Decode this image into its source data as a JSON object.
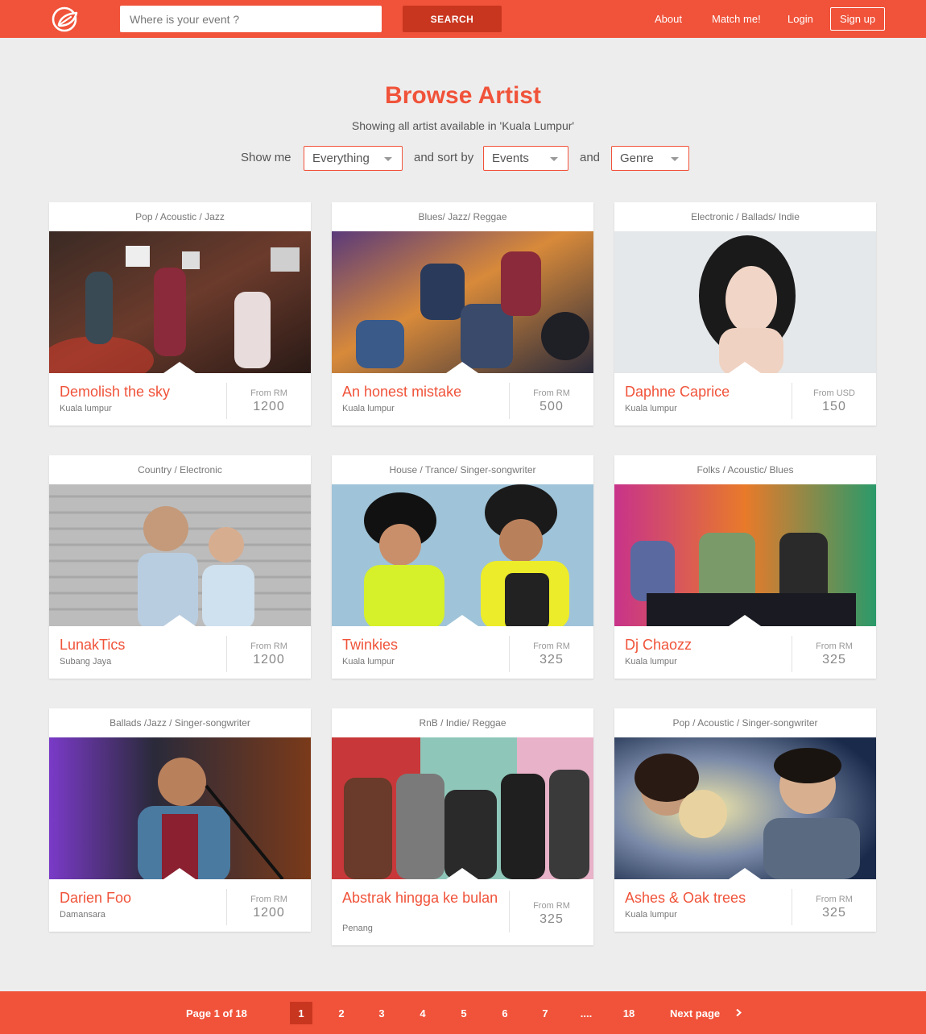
{
  "header": {
    "search_placeholder": "Where is your event ?",
    "search_button": "SEARCH",
    "nav": [
      "About",
      "Match me!",
      "Login"
    ],
    "signup": "Sign up",
    "logo_icon": "leaf-logo-icon"
  },
  "main": {
    "title": "Browse Artist",
    "subtitle": "Showing all artist available in 'Kuala Lumpur'",
    "filters": {
      "show_me_label": "Show me",
      "show_me_value": "Everything",
      "sort_label": "and sort by",
      "sort_value": "Events",
      "and_label": "and",
      "genre_value": "Genre"
    }
  },
  "artists": [
    {
      "genre": "Pop / Acoustic / Jazz",
      "name": "Demolish the sky",
      "city": "Kuala lumpur",
      "from": "From RM",
      "price": "1200"
    },
    {
      "genre": "Blues/ Jazz/ Reggae",
      "name": "An honest mistake",
      "city": "Kuala lumpur",
      "from": "From RM",
      "price": "500"
    },
    {
      "genre": "Electronic / Ballads/ Indie",
      "name": "Daphne Caprice",
      "city": "Kuala lumpur",
      "from": "From USD",
      "price": "150"
    },
    {
      "genre": "Country / Electronic",
      "name": "LunakTics",
      "city": "Subang Jaya",
      "from": "From RM",
      "price": "1200"
    },
    {
      "genre": "House / Trance/ Singer-songwriter",
      "name": "Twinkies",
      "city": "Kuala lumpur",
      "from": "From RM",
      "price": "325"
    },
    {
      "genre": "Folks / Acoustic/ Blues",
      "name": "Dj Chaozz",
      "city": "Kuala lumpur",
      "from": "From RM",
      "price": "325"
    },
    {
      "genre": "Ballads /Jazz / Singer-songwriter",
      "name": "Darien Foo",
      "city": "Damansara",
      "from": "From RM",
      "price": "1200"
    },
    {
      "genre": "RnB / Indie/ Reggae",
      "name": "Abstrak hingga ke bulan",
      "city": "Penang",
      "from": "From RM",
      "price": "325"
    },
    {
      "genre": "Pop / Acoustic / Singer-songwriter",
      "name": "Ashes & Oak trees",
      "city": "Kuala lumpur",
      "from": "From RM",
      "price": "325"
    }
  ],
  "pagination": {
    "info": "Page 1 of 18",
    "pages": [
      "1",
      "2",
      "3",
      "4",
      "5",
      "6",
      "7",
      "....",
      "18"
    ],
    "current": "1",
    "next": "Next page",
    "next_icon": "chevron-right-icon"
  },
  "colors": {
    "brand": "#f0533a",
    "brand_dark": "#c9361f",
    "background": "#ededed"
  }
}
